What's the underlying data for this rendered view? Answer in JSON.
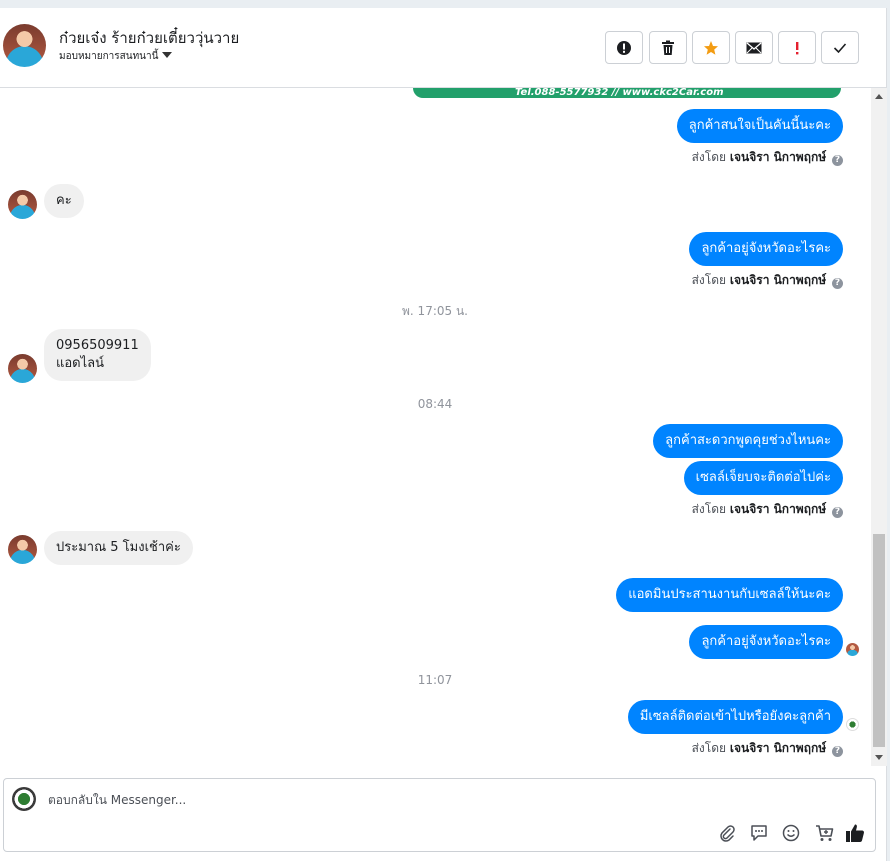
{
  "header": {
    "contact_name": "ก๋วยเจ๋ง ร้ายก๋วยเตี๋ยววุ่นวาย",
    "assign_label": "มอบหมายการสนทนานี้",
    "buttons": [
      "mark-spam",
      "delete",
      "star",
      "email",
      "follow-up",
      "done"
    ]
  },
  "conversation": {
    "banner_text": "Tel.088-5577932  //  www.ckc2Car.com",
    "sent_by_prefix": "ส่งโดย",
    "sender_name": "เจนจิรา นิกาพฤกษ์",
    "help_glyph": "?",
    "messages": [
      {
        "dir": "out",
        "text": "ลูกค้าสนใจเป็นคันนี้นะคะ"
      },
      {
        "dir": "in",
        "text": "คะ"
      },
      {
        "dir": "out",
        "text": "ลูกค้าอยู่จังหวัดอะไรคะ"
      },
      {
        "dir": "ts",
        "text": "พ. 17:05 น."
      },
      {
        "dir": "in",
        "line1": "0956509911",
        "line2": "แอดไลน์"
      },
      {
        "dir": "ts",
        "text": "08:44"
      },
      {
        "dir": "out",
        "text": "ลูกค้าสะดวกพูดคุยช่วงไหนคะ"
      },
      {
        "dir": "out",
        "text": "เซลล์เจ็ยบจะติดต่อไปค่ะ"
      },
      {
        "dir": "in",
        "text": "ประมาณ 5 โมงเช้าค่ะ"
      },
      {
        "dir": "out",
        "text": "แอดมินประสานงานกับเซลล์ให้นะคะ"
      },
      {
        "dir": "out",
        "text": "ลูกค้าอยู่จังหวัดอะไรคะ"
      },
      {
        "dir": "ts",
        "text": "11:07"
      },
      {
        "dir": "out",
        "text": "มีเซลล์ติดต่อเข้าไปหรือยังคะลูกค้า"
      }
    ]
  },
  "composer": {
    "placeholder": "ตอบกลับใน Messenger...",
    "icons": [
      "attach-icon",
      "saved-replies-icon",
      "emoji-icon",
      "shop-icon",
      "like-icon"
    ]
  },
  "colors": {
    "outgoing_bubble": "#0084ff",
    "incoming_bubble": "#f0f0f0",
    "star": "#f39c12",
    "alert": "#e4202e"
  }
}
